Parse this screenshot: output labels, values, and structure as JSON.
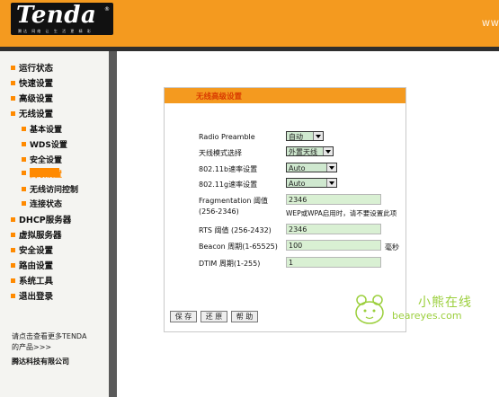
{
  "header": {
    "brand": "Tenda",
    "reg_mark": "®",
    "tagline": "腾达 网络 让 生 活 更 精 彩",
    "url_fragment": "WW"
  },
  "sidebar": {
    "items": [
      {
        "label": "运行状态",
        "sub": false
      },
      {
        "label": "快速设置",
        "sub": false
      },
      {
        "label": "高级设置",
        "sub": false
      },
      {
        "label": "无线设置",
        "sub": false
      },
      {
        "label": "基本设置",
        "sub": true
      },
      {
        "label": "WDS设置",
        "sub": true
      },
      {
        "label": "安全设置",
        "sub": true
      },
      {
        "label": "高级设置",
        "sub": true,
        "active": true
      },
      {
        "label": "无线访问控制",
        "sub": true
      },
      {
        "label": "连接状态",
        "sub": true
      },
      {
        "label": "DHCP服务器",
        "sub": false
      },
      {
        "label": "虚拟服务器",
        "sub": false
      },
      {
        "label": "安全设置",
        "sub": false
      },
      {
        "label": "路由设置",
        "sub": false
      },
      {
        "label": "系统工具",
        "sub": false
      },
      {
        "label": "退出登录",
        "sub": false
      }
    ],
    "more_line1": "请点击查看更多TENDA",
    "more_line2": "的产品>>>",
    "company": "腾达科技有限公司"
  },
  "panel": {
    "title": "无线高级设置",
    "fields": {
      "radio_preamble": {
        "label": "Radio Preamble",
        "value": "自动"
      },
      "antenna_mode": {
        "label": "天线模式选择",
        "value": "外置天线"
      },
      "rate_11b": {
        "label": "802.11b速率设置",
        "value": "Auto"
      },
      "rate_11g": {
        "label": "802.11g速率设置",
        "value": "Auto"
      },
      "fragmentation": {
        "label": "Fragmentation 阈值",
        "range": "(256-2346)",
        "value": "2346",
        "note": "WEP或WPA启用时，请不要设置此项"
      },
      "rts": {
        "label": "RTS 阈值 (256-2432)",
        "value": "2346"
      },
      "beacon": {
        "label": "Beacon 周期(1-65525)",
        "value": "100",
        "unit": "毫秒"
      },
      "dtim": {
        "label": "DTIM 周期(1-255)",
        "value": "1"
      }
    },
    "buttons": {
      "save": "保 存",
      "restore": "还 原",
      "help": "帮 助"
    }
  },
  "watermark": {
    "title": "小熊在线",
    "site": "beareyes.com"
  },
  "colors": {
    "header_orange": "#f49a1f",
    "nav_bullet": "#ff8a00",
    "input_green": "#d9f0d3",
    "watermark_green": "#9bcf3c"
  }
}
